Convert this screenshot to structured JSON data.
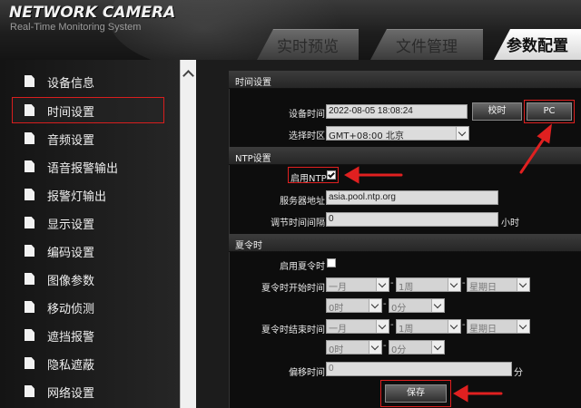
{
  "brand": {
    "title": "NETWORK CAMERA",
    "subtitle": "Real-Time Monitoring System"
  },
  "tabs": [
    {
      "label": "实时预览"
    },
    {
      "label": "文件管理"
    },
    {
      "label": "参数配置"
    }
  ],
  "sidebar": {
    "items": [
      {
        "label": "设备信息"
      },
      {
        "label": "时间设置"
      },
      {
        "label": "音频设置"
      },
      {
        "label": "语音报警输出"
      },
      {
        "label": "报警灯输出"
      },
      {
        "label": "显示设置"
      },
      {
        "label": "编码设置"
      },
      {
        "label": "图像参数"
      },
      {
        "label": "移动侦测"
      },
      {
        "label": "遮挡报警"
      },
      {
        "label": "隐私遮蔽"
      },
      {
        "label": "网络设置"
      }
    ]
  },
  "time": {
    "section_title": "时间设置",
    "device_time_label": "设备时间",
    "device_time_value": "2022-08-05 18:08:24",
    "calibrate_button": "校时",
    "pc_button": "PC",
    "timezone_label": "选择时区",
    "timezone_value": "GMT+08:00 北京"
  },
  "ntp": {
    "section_title": "NTP设置",
    "enable_label": "启用NTP",
    "enabled": true,
    "server_label": "服务器地址",
    "server_value": "asia.pool.ntp.org",
    "interval_label": "调节时间间隔",
    "interval_value": "0",
    "interval_unit": "小时"
  },
  "dst": {
    "section_title": "夏令时",
    "enable_label": "启用夏令时",
    "enabled": false,
    "start_label": "夏令时开始时间",
    "end_label": "夏令时结束时间",
    "month_value": "一月",
    "week_value": "1周",
    "weekday_value": "星期日",
    "hour_value": "0时",
    "minute_value": "0分",
    "offset_label": "偏移时间",
    "offset_value": "0",
    "offset_unit": "分",
    "dash": "-"
  },
  "save_button": "保存",
  "colors": {
    "highlight": "#e02020",
    "panel": "#0d0d0d",
    "accent_tab": "#ffffff"
  }
}
